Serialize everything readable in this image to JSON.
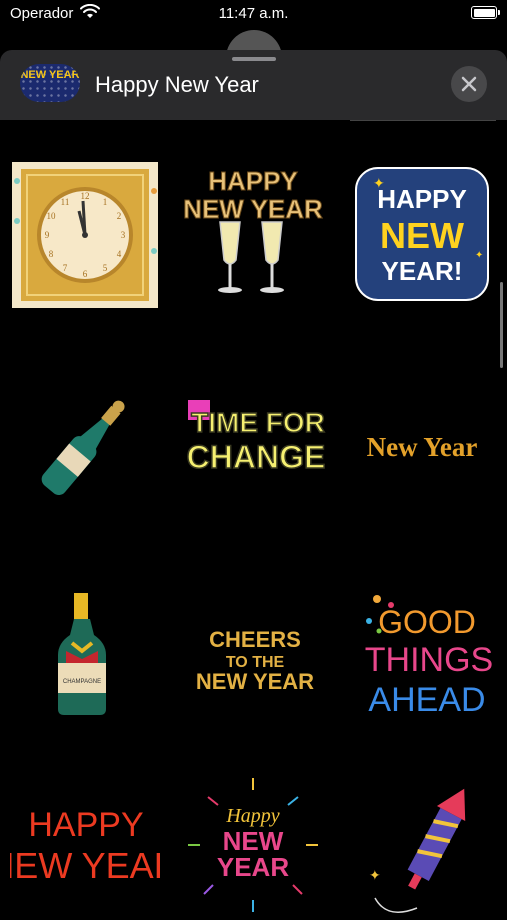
{
  "status_bar": {
    "carrier": "Operador",
    "time": "11:47 a.m."
  },
  "header": {
    "title": "Happy New Year",
    "app_icon_text": "NEW YEAR",
    "close_icon": "close-icon"
  },
  "stickers": [
    {
      "name": "clock",
      "text": ""
    },
    {
      "name": "happy-new-year-champagne-glasses",
      "line1": "HAPPY",
      "line2": "NEW YEAR"
    },
    {
      "name": "happy-new-year-blue-badge",
      "line1": "HAPPY",
      "line2": "NEW",
      "line3": "YEAR!"
    },
    {
      "name": "champagne-bottle-popping",
      "text": ""
    },
    {
      "name": "time-for-change",
      "line1": "TIME FOR",
      "line2": "CHANGE"
    },
    {
      "name": "new-year-gold-text",
      "text": "New Year"
    },
    {
      "name": "champagne-bottle",
      "label": "CHAMPAGNE"
    },
    {
      "name": "cheers-to-the-new-year",
      "line1": "CHEERS",
      "line2": "TO THE",
      "line3": "NEW YEAR"
    },
    {
      "name": "good-things-ahead",
      "line1": "GOOD",
      "line2": "THINGS",
      "line3": "AHEAD"
    },
    {
      "name": "happy-new-year-red",
      "line1": "HAPPY",
      "line2": "NEW YEAR"
    },
    {
      "name": "happy-new-year-fireworks",
      "line1": "Happy",
      "line2": "NEW",
      "line3": "YEAR"
    },
    {
      "name": "firework-rocket",
      "text": ""
    }
  ]
}
